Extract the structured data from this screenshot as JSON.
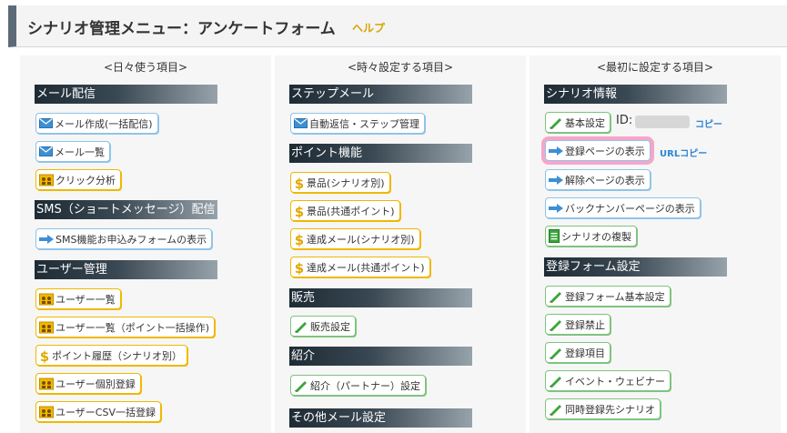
{
  "header": {
    "title": "シナリオ管理メニュー：アンケートフォーム",
    "help": "ヘルプ"
  },
  "col1": {
    "title": "<日々使う項目>",
    "sections": {
      "mail": "メール配信",
      "sms": "SMS（ショートメッセージ）配信",
      "users": "ユーザー管理"
    },
    "buttons": {
      "mail_create": "メール作成(一括配信)",
      "mail_list": "メール一覧",
      "click_analysis": "クリック分析",
      "sms_form": "SMS機能お申込みフォームの表示",
      "user_list": "ユーザー一覧",
      "user_list_points": "ユーザー一覧（ポイント一括操作)",
      "point_history": "ポイント履歴（シナリオ別）",
      "user_register": "ユーザー個別登録",
      "user_csv": "ユーザーCSV一括登録"
    }
  },
  "col2": {
    "title": "<時々設定する項目>",
    "sections": {
      "step_mail": "ステップメール",
      "points": "ポイント機能",
      "sales": "販売",
      "referral": "紹介",
      "other_mail": "その他メール設定"
    },
    "buttons": {
      "auto_reply": "自動返信・ステップ管理",
      "prize_scenario": "景品(シナリオ別)",
      "prize_common": "景品(共通ポイント)",
      "achieve_scenario": "達成メール(シナリオ別)",
      "achieve_common": "達成メール(共通ポイント)",
      "sales_settings": "販売設定",
      "referral_settings": "紹介（パートナー）設定"
    }
  },
  "col3": {
    "title": "<最初に設定する項目>",
    "sections": {
      "scenario_info": "シナリオ情報",
      "form_settings": "登録フォーム設定"
    },
    "buttons": {
      "basic_settings": "基本設定",
      "show_register_page": "登録ページの表示",
      "show_cancel_page": "解除ページの表示",
      "show_backnumber": "バックナンバーページの表示",
      "duplicate_scenario": "シナリオの複製",
      "form_basic": "登録フォーム基本設定",
      "register_ban": "登録禁止",
      "register_items": "登録項目",
      "event_webinar": "イベント・ウェビナー",
      "simultaneous_register": "同時登録先シナリオ"
    },
    "id_label": "ID:",
    "copy": "コピー",
    "url_copy": "URLコピー"
  },
  "colors": {
    "header_bar": "#5d6b78",
    "help": "#d9a400",
    "link": "#2a86d6",
    "highlight": "#f6a6c8",
    "blue": "#8fc4e8",
    "gold": "#f0b800",
    "green": "#7fc37f"
  }
}
